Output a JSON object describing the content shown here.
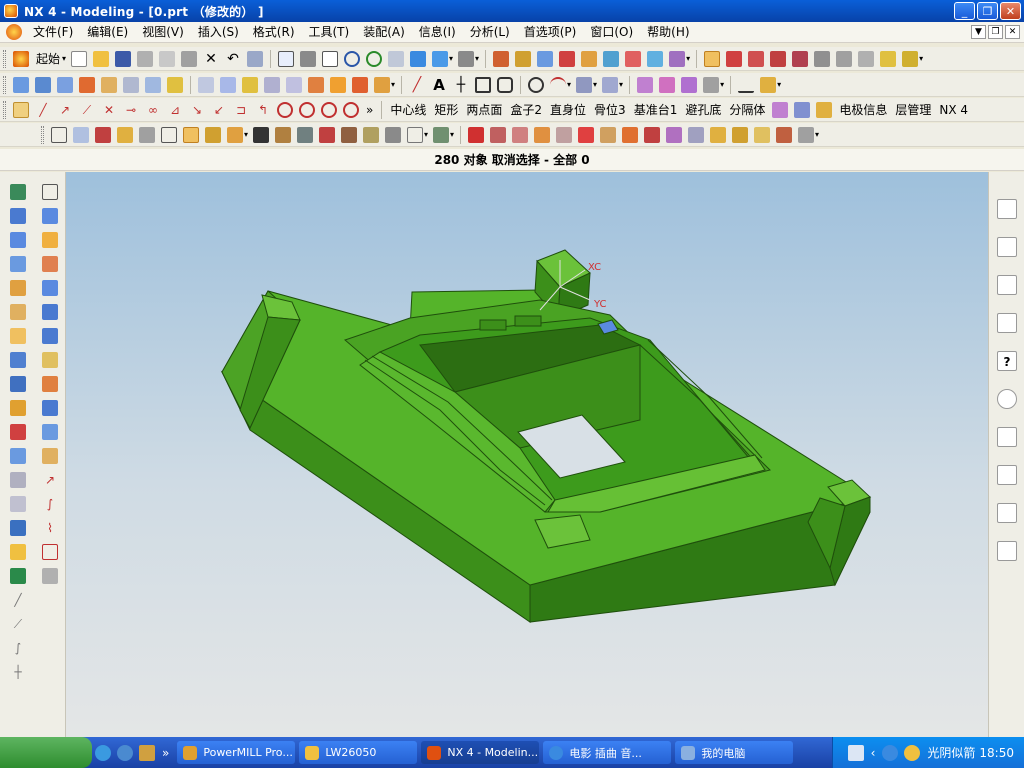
{
  "window": {
    "title": "NX 4 - Modeling - [0.prt （修改的） ]"
  },
  "menu": [
    "文件(F)",
    "编辑(E)",
    "视图(V)",
    "插入(S)",
    "格式(R)",
    "工具(T)",
    "装配(A)",
    "信息(I)",
    "分析(L)",
    "首选项(P)",
    "窗口(O)",
    "帮助(H)"
  ],
  "toolbar1": {
    "start_label": "起始"
  },
  "toolbar3": {
    "items": [
      "中心线",
      "矩形",
      "两点面",
      "盒子2",
      "直身位",
      "骨位3",
      "基准台1",
      "避孔底",
      "分隔体",
      "电极信息",
      "层管理",
      "NX 4"
    ]
  },
  "status": {
    "message": "280 对象 取消选择 - 全部 0"
  },
  "csys": {
    "xc": "XC",
    "yc": "YC"
  },
  "taskbar": {
    "items": [
      "PowerMILL Pro...",
      "LW26050",
      "NX 4 - Modelin...",
      "电影 插曲 音...",
      "我的电脑"
    ],
    "clock": "18:50",
    "tray_text": "光阴似箭"
  },
  "colors": {
    "model_top": "#55b42a",
    "model_side": "#3c8f1a",
    "model_dark": "#2c6e12",
    "viewport_top": "#9ec0dc"
  }
}
